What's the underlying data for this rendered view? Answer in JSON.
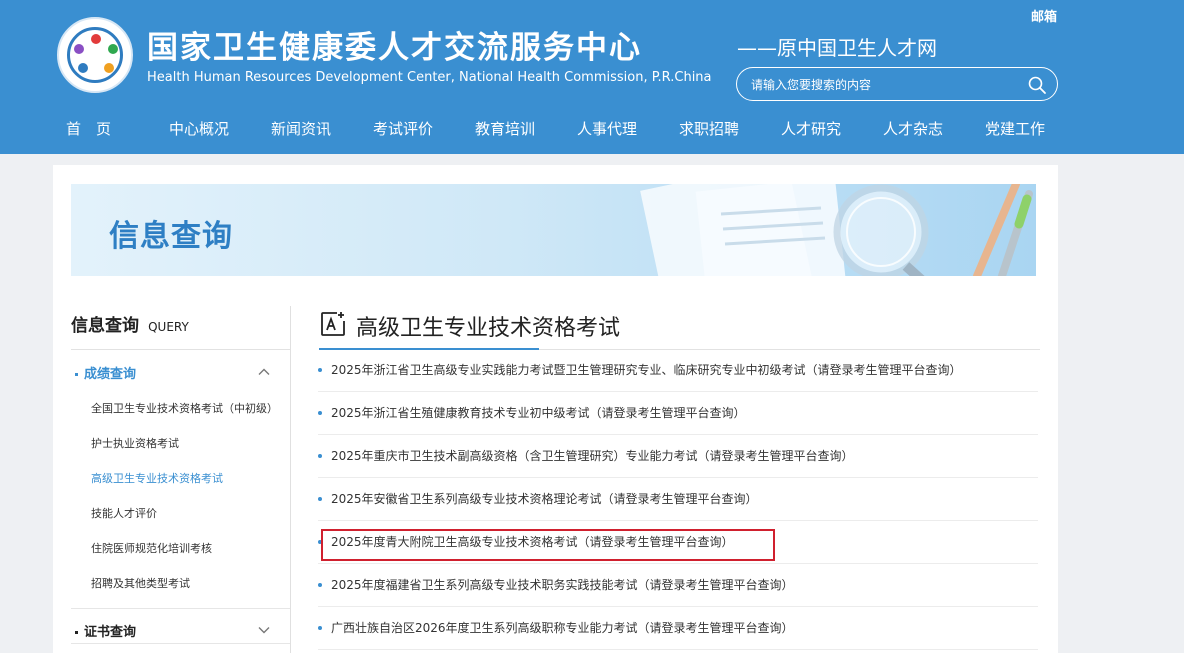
{
  "header": {
    "org_name_cn": "国家卫生健康委人才交流服务中心",
    "org_name_en": "Health Human Resources Development Center, National Health Commission, P.R.China",
    "org_subtitle": "——原中国卫生人才网",
    "mailbox_label": "邮箱",
    "search_placeholder": "请输入您要搜索的内容",
    "nav": [
      "首　页",
      "中心概况",
      "新闻资讯",
      "考试评价",
      "教育培训",
      "人事代理",
      "求职招聘",
      "人才研究",
      "人才杂志",
      "党建工作"
    ]
  },
  "banner": {
    "title": "信息查询"
  },
  "sidebar": {
    "title_cn": "信息查询",
    "title_en": "QUERY",
    "categories": [
      {
        "label": "成绩查询",
        "expanded": true,
        "items": [
          "全国卫生专业技术资格考试（中初级）",
          "护士执业资格考试",
          "高级卫生专业技术资格考试",
          "技能人才评价",
          "住院医师规范化培训考核",
          "招聘及其他类型考试"
        ],
        "active_item": "高级卫生专业技术资格考试"
      },
      {
        "label": "证书查询",
        "expanded": false,
        "items": []
      }
    ]
  },
  "content": {
    "section_title": "高级卫生专业技术资格考试",
    "items": [
      "2025年浙江省卫生高级专业实践能力考试暨卫生管理研究专业、临床研究专业中初级考试（请登录考生管理平台查询）",
      "2025年浙江省生殖健康教育技术专业初中级考试（请登录考生管理平台查询）",
      "2025年重庆市卫生技术副高级资格（含卫生管理研究）专业能力考试（请登录考生管理平台查询）",
      "2025年安徽省卫生系列高级专业技术资格理论考试（请登录考生管理平台查询）",
      "2025年度青大附院卫生高级专业技术资格考试（请登录考生管理平台查询）",
      "2025年度福建省卫生系列高级专业技术职务实践技能考试（请登录考生管理平台查询）",
      "广西壮族自治区2026年度卫生系列高级职称专业能力考试（请登录考生管理平台查询）"
    ],
    "highlighted_index": 4
  },
  "colors": {
    "header_bg": "#3a8fd1",
    "accent": "#2e7fc4",
    "highlight_border": "#d0202e"
  },
  "icons": {
    "logo": "emblem-logo",
    "search": "search-icon",
    "section": "exam-edit-icon",
    "expand": "chevron-up-icon",
    "collapse": "chevron-down-icon"
  }
}
